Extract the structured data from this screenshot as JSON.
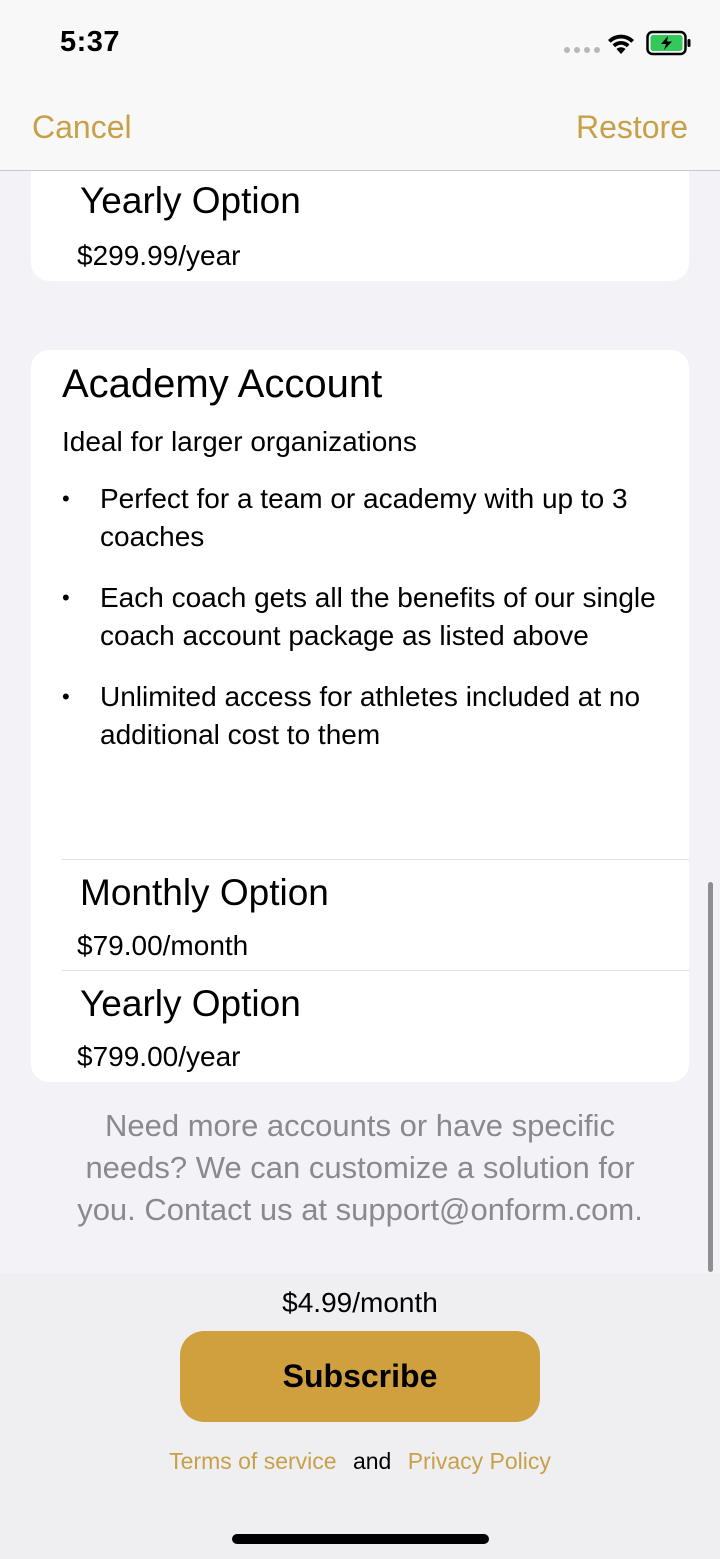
{
  "status_bar": {
    "time": "5:37",
    "icons": [
      "cellular-dots-icon",
      "wifi-icon",
      "battery-charging-icon"
    ],
    "battery_color": "#34c759"
  },
  "nav": {
    "cancel_label": "Cancel",
    "restore_label": "Restore",
    "accent_color": "#c9a04a"
  },
  "single_coach_card": {
    "yearly_option": {
      "title": "Yearly Option",
      "price": "$299.99/year"
    }
  },
  "academy_card": {
    "title": "Academy Account",
    "subtitle": "Ideal for larger organizations",
    "bullet_symbol": "•",
    "bullets": [
      "Perfect for a team or academy with up to 3 coaches",
      "Each coach gets all the benefits of our single coach account package as listed above",
      "Unlimited access for athletes included at no additional cost to them"
    ],
    "monthly_option": {
      "title": "Monthly Option",
      "price": "$79.00/month"
    },
    "yearly_option": {
      "title": "Yearly Option",
      "price": "$799.00/year"
    }
  },
  "contact_text": "Need more accounts or have specific needs? We can customize a solution for you. Contact us at support@onform.com.",
  "footer": {
    "selected_price": "$4.99/month",
    "subscribe_label": "Subscribe",
    "button_color": "#d0a03e",
    "terms_label": "Terms of service",
    "and_label": "and",
    "privacy_label": "Privacy Policy"
  }
}
